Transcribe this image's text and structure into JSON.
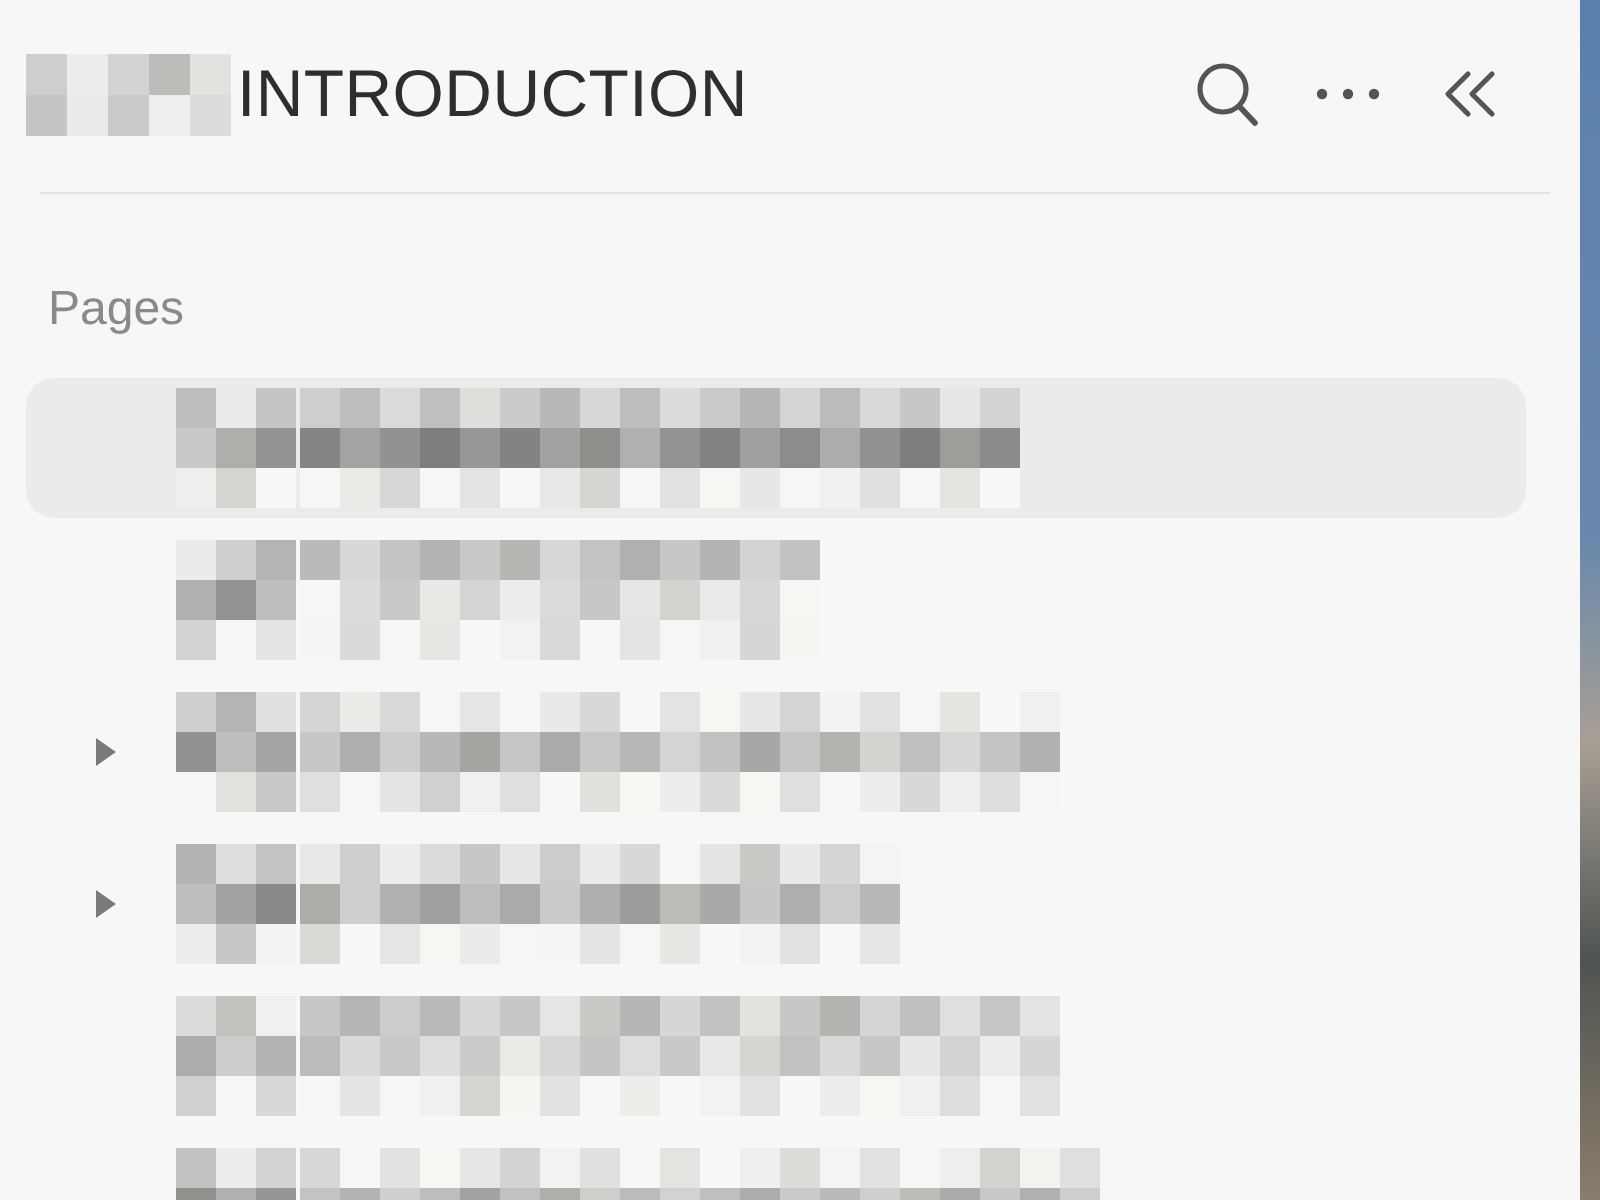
{
  "header": {
    "title": "INTRODUCTION"
  },
  "sections": [
    {
      "label": "Pages",
      "items": [
        {
          "kind": "page",
          "selected": true
        },
        {
          "kind": "page",
          "selected": false
        },
        {
          "kind": "group",
          "selected": false,
          "expanded": false
        },
        {
          "kind": "group",
          "selected": false,
          "expanded": false
        },
        {
          "kind": "page",
          "selected": false
        },
        {
          "kind": "page",
          "selected": false
        }
      ]
    }
  ]
}
